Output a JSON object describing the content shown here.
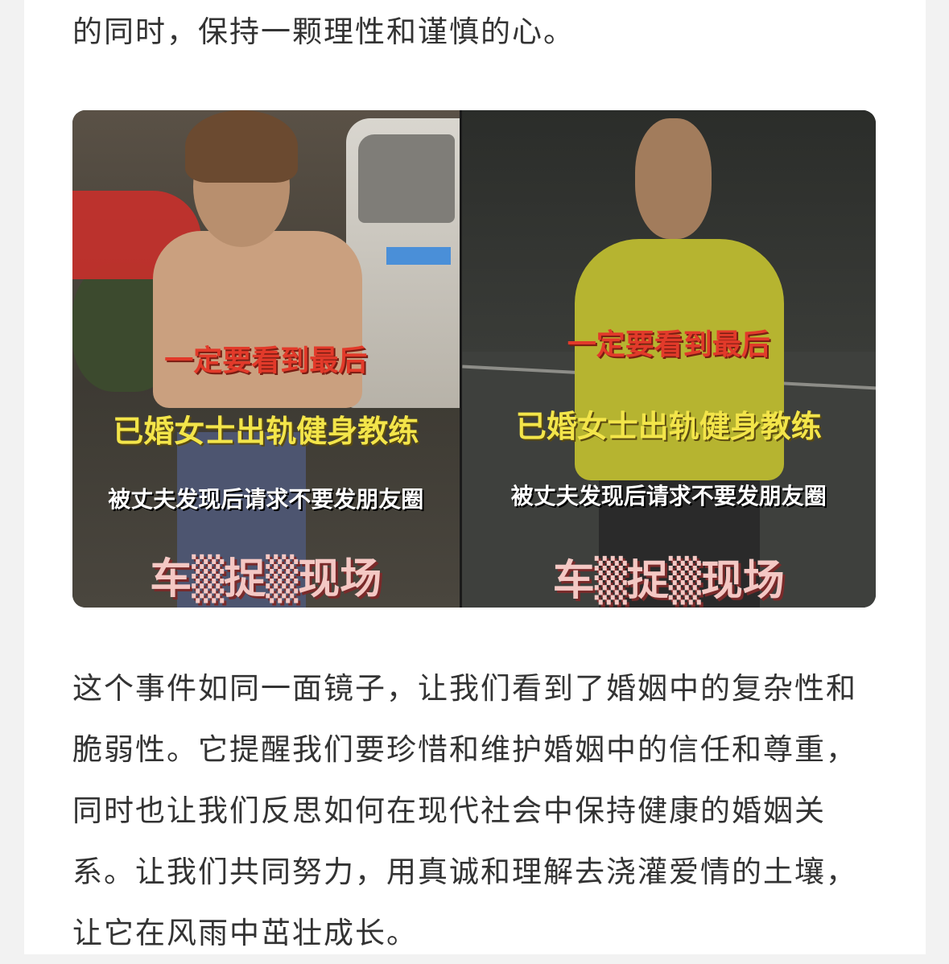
{
  "article": {
    "top_paragraph": "的同时，保持一颗理性和谨慎的心。",
    "bottom_paragraph": "这个事件如同一面镜子，让我们看到了婚姻中的复杂性和脆弱性。它提醒我们要珍惜和维护婚姻中的信任和尊重，同时也让我们反思如何在现代社会中保持健康的婚姻关系。让我们共同努力，用真诚和理解去浇灌爱情的土壤，让它在风雨中茁壮成长。"
  },
  "image": {
    "left_panel": {
      "caption_red": "一定要看到最后",
      "caption_yellow": "已婚女士出轨健身教练",
      "caption_white": "被丈夫发现后请求不要发朋友圈",
      "caption_pink": "车▒捉▒现场"
    },
    "right_panel": {
      "caption_red": "一定要看到最后",
      "caption_yellow": "已婚女士出轨健身教练",
      "caption_white": "被丈夫发现后请求不要发朋友圈",
      "caption_pink": "车▒捉▒现场"
    }
  },
  "colors": {
    "page_background": "#f2f2f2",
    "card_background": "#ffffff",
    "body_text": "#333333",
    "caption_red": "#e23a2a",
    "caption_yellow": "#f3e54a"
  }
}
